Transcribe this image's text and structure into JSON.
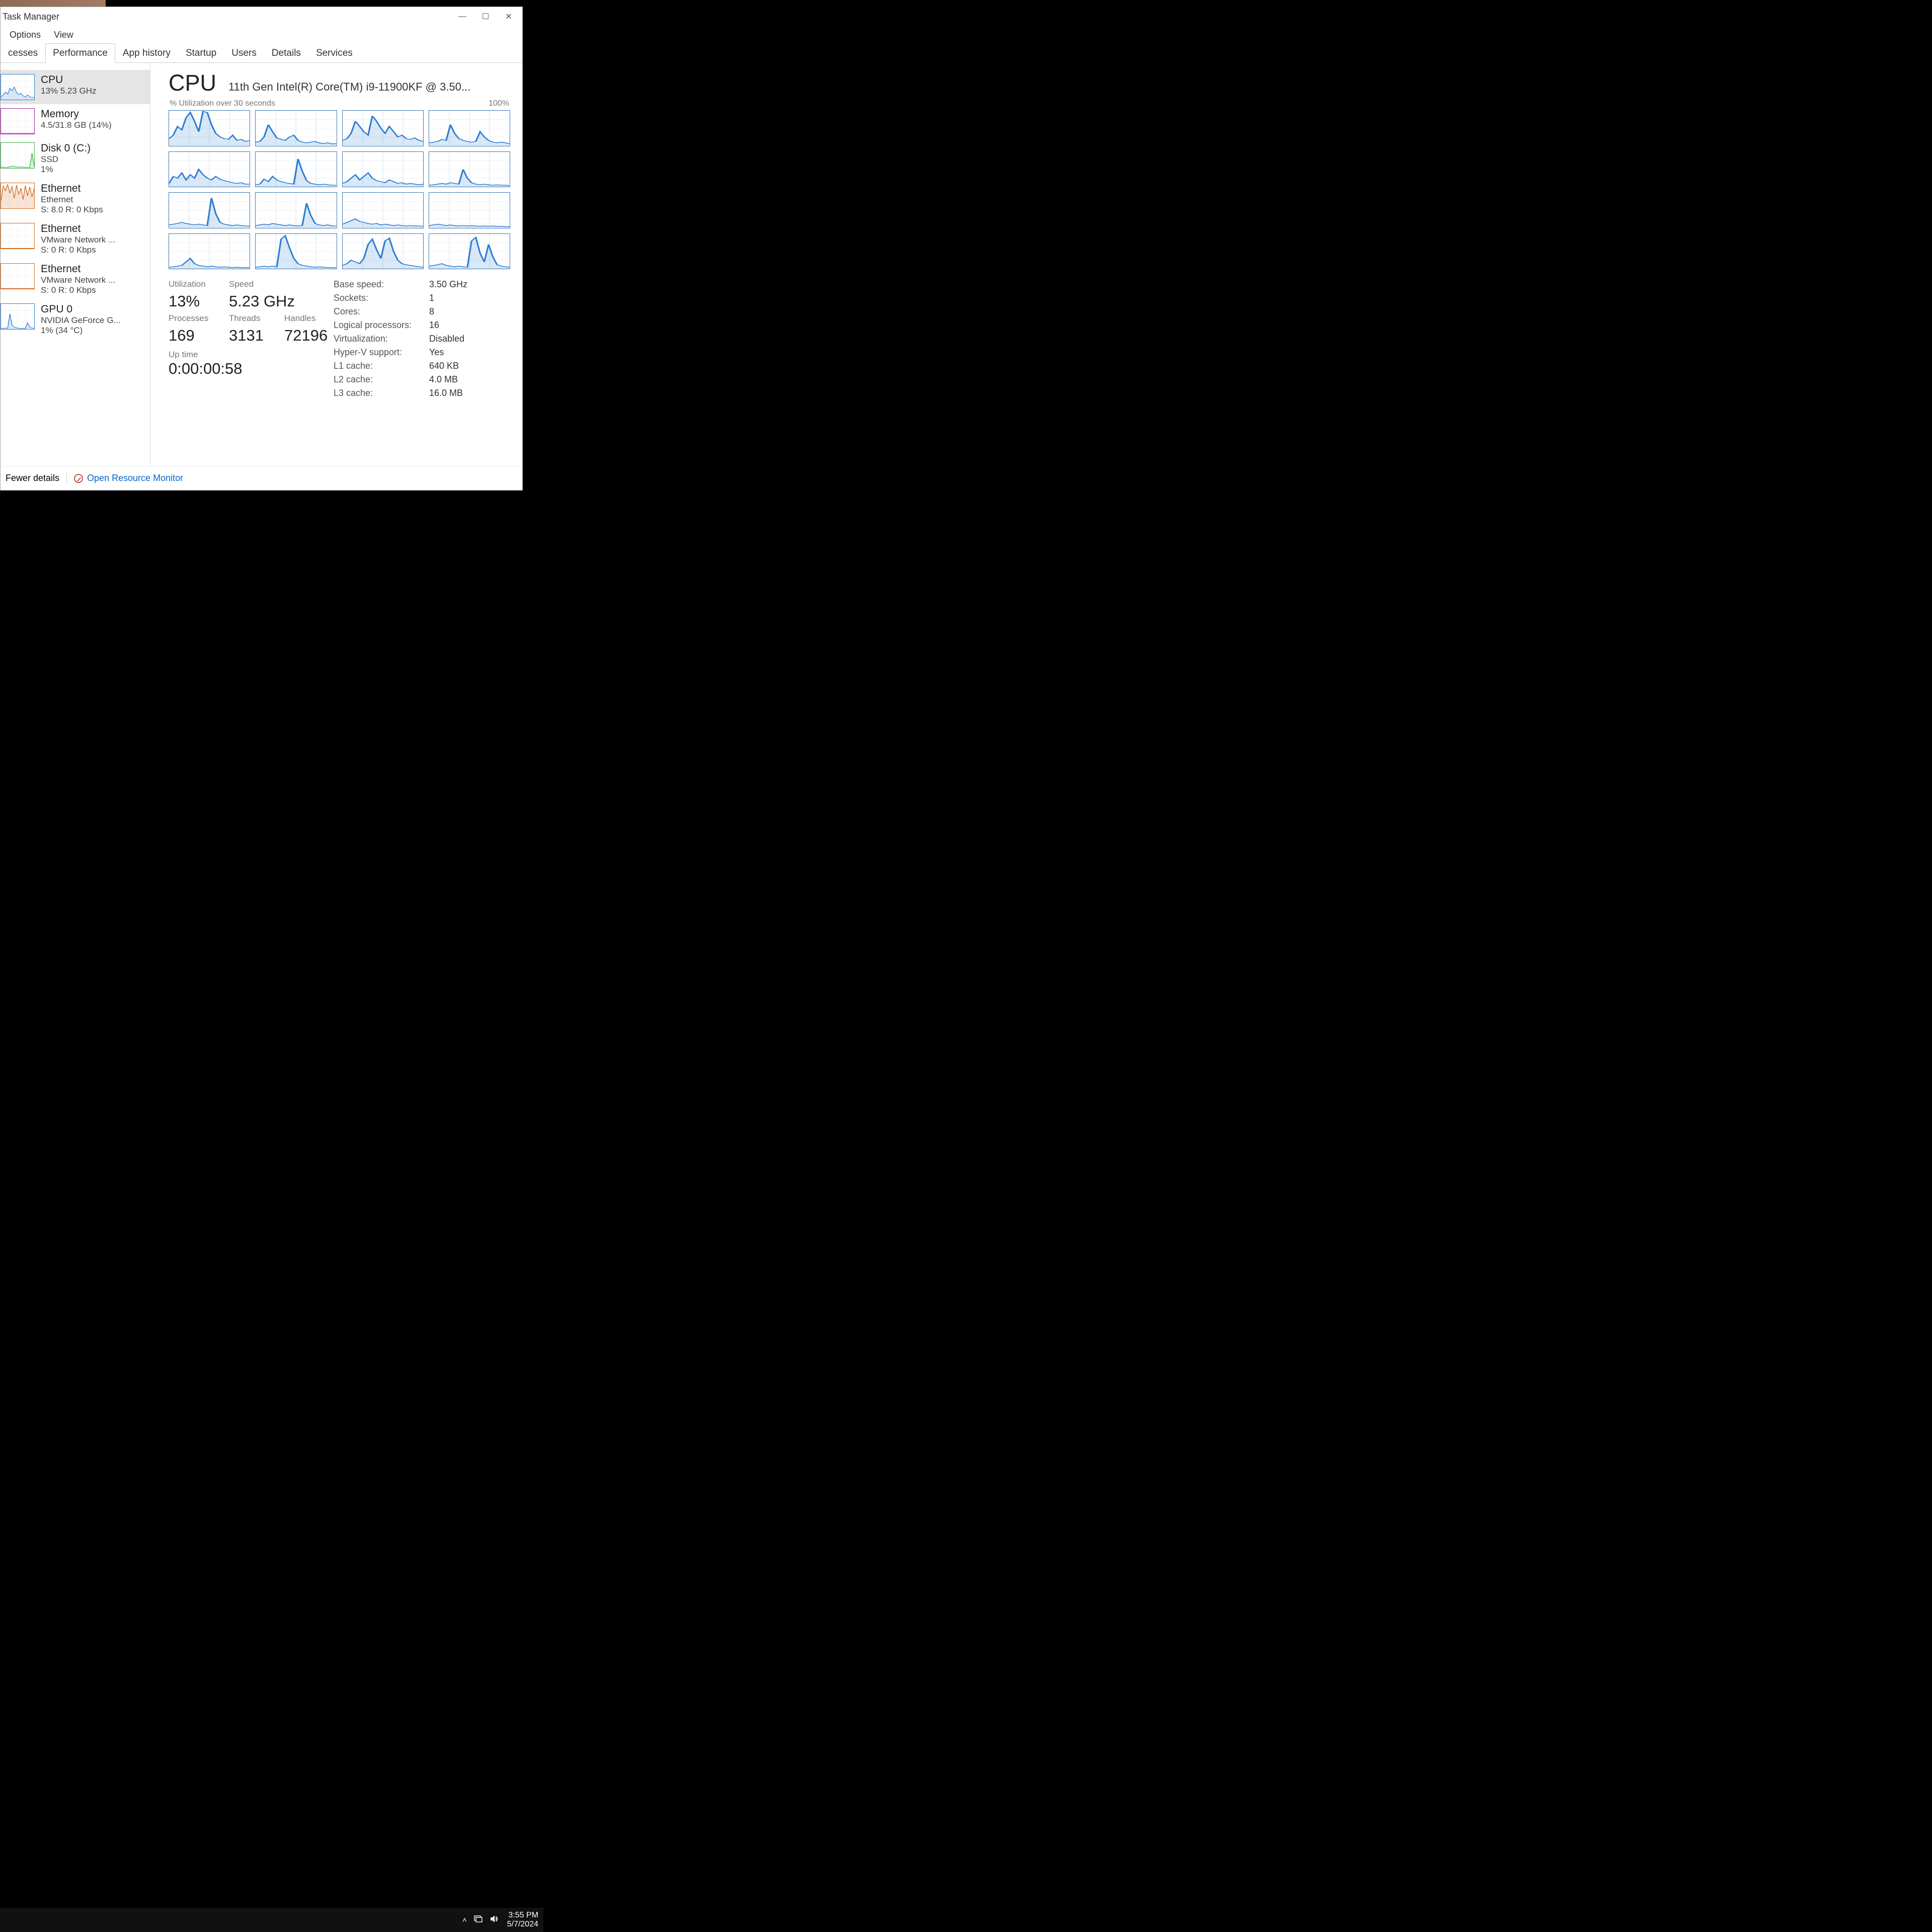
{
  "window": {
    "title": "Task Manager",
    "controls": {
      "min": "—",
      "max": "☐",
      "close": "✕"
    }
  },
  "menu": {
    "items": [
      "Options",
      "View"
    ]
  },
  "tabs": {
    "items": [
      "cesses",
      "Performance",
      "App history",
      "Startup",
      "Users",
      "Details",
      "Services"
    ],
    "active_index": 1
  },
  "sidebar": {
    "items": [
      {
        "id": "cpu",
        "title": "CPU",
        "line2": "13%  5.23 GHz",
        "color": "#2d7dd2"
      },
      {
        "id": "memory",
        "title": "Memory",
        "line2": "4.5/31.8 GB (14%)",
        "color": "#a020a0"
      },
      {
        "id": "disk0",
        "title": "Disk 0 (C:)",
        "line2": "SSD",
        "line3": "1%",
        "color": "#3cb043"
      },
      {
        "id": "eth0",
        "title": "Ethernet",
        "line2": "Ethernet",
        "line3": "S: 8.0 R: 0 Kbps",
        "color": "#d2691e"
      },
      {
        "id": "eth1",
        "title": "Ethernet",
        "line2": "VMware Network ...",
        "line3": "S: 0 R: 0 Kbps",
        "color": "#d2691e"
      },
      {
        "id": "eth2",
        "title": "Ethernet",
        "line2": "VMware Network ...",
        "line3": "S: 0 R: 0 Kbps",
        "color": "#d2691e"
      },
      {
        "id": "gpu0",
        "title": "GPU 0",
        "line2": "NVIDIA GeForce G...",
        "line3": "1%  (34 °C)",
        "color": "#2d7dd2"
      }
    ],
    "selected_index": 0
  },
  "main": {
    "heading": "CPU",
    "model": "11th Gen Intel(R) Core(TM) i9-11900KF @ 3.50...",
    "chart_left_label": "% Utilization over 30 seconds",
    "chart_right_label": "100%"
  },
  "stats_left": {
    "utilization_label": "Utilization",
    "utilization_value": "13%",
    "speed_label": "Speed",
    "speed_value": "5.23 GHz",
    "processes_label": "Processes",
    "processes_value": "169",
    "threads_label": "Threads",
    "threads_value": "3131",
    "handles_label": "Handles",
    "handles_value": "72196",
    "uptime_label": "Up time",
    "uptime_value": "0:00:00:58"
  },
  "stats_right": [
    {
      "label": "Base speed:",
      "value": "3.50 GHz"
    },
    {
      "label": "Sockets:",
      "value": "1"
    },
    {
      "label": "Cores:",
      "value": "8"
    },
    {
      "label": "Logical processors:",
      "value": "16"
    },
    {
      "label": "Virtualization:",
      "value": "Disabled"
    },
    {
      "label": "Hyper-V support:",
      "value": "Yes"
    },
    {
      "label": "L1 cache:",
      "value": "640 KB"
    },
    {
      "label": "L2 cache:",
      "value": "4.0 MB"
    },
    {
      "label": "L3 cache:",
      "value": "16.0 MB"
    }
  ],
  "footer": {
    "fewer_details": "Fewer details",
    "resource_monitor": "Open Resource Monitor"
  },
  "taskbar": {
    "time": "3:55 PM",
    "date": "5/7/2024"
  },
  "chart_data": {
    "type": "line",
    "title": "% Utilization over 30 seconds",
    "x_range_seconds": 30,
    "ylim": [
      0,
      100
    ],
    "series_count": 16,
    "note": "16 logical-processor sparklines; values approximated from pixels",
    "series": [
      {
        "name": "LP0",
        "values": [
          20,
          30,
          55,
          45,
          80,
          95,
          70,
          40,
          98,
          95,
          60,
          35,
          25,
          20,
          18,
          30,
          15,
          18,
          12,
          15
        ]
      },
      {
        "name": "LP1",
        "values": [
          10,
          12,
          25,
          60,
          40,
          22,
          18,
          15,
          25,
          30,
          15,
          10,
          8,
          10,
          12,
          8,
          6,
          8,
          5,
          6
        ]
      },
      {
        "name": "LP2",
        "values": [
          15,
          20,
          35,
          70,
          55,
          40,
          30,
          85,
          70,
          50,
          35,
          55,
          40,
          25,
          30,
          20,
          18,
          22,
          15,
          12
        ]
      },
      {
        "name": "LP3",
        "values": [
          8,
          10,
          12,
          18,
          15,
          60,
          35,
          20,
          15,
          12,
          10,
          12,
          40,
          25,
          15,
          10,
          8,
          10,
          8,
          6
        ]
      },
      {
        "name": "LP4",
        "values": [
          10,
          30,
          25,
          40,
          20,
          35,
          25,
          50,
          35,
          25,
          20,
          30,
          22,
          18,
          15,
          12,
          10,
          12,
          8,
          8
        ]
      },
      {
        "name": "LP5",
        "values": [
          6,
          8,
          22,
          15,
          30,
          20,
          15,
          12,
          10,
          8,
          80,
          45,
          18,
          10,
          8,
          6,
          8,
          6,
          5,
          5
        ]
      },
      {
        "name": "LP6",
        "values": [
          10,
          15,
          25,
          35,
          20,
          30,
          40,
          25,
          18,
          15,
          12,
          20,
          15,
          10,
          12,
          8,
          10,
          8,
          6,
          8
        ]
      },
      {
        "name": "LP7",
        "values": [
          5,
          6,
          8,
          10,
          8,
          12,
          10,
          8,
          50,
          25,
          12,
          8,
          6,
          8,
          6,
          5,
          6,
          5,
          5,
          4
        ]
      },
      {
        "name": "LP8",
        "values": [
          8,
          10,
          12,
          15,
          12,
          10,
          8,
          10,
          8,
          6,
          85,
          40,
          15,
          10,
          8,
          6,
          8,
          6,
          5,
          5
        ]
      },
      {
        "name": "LP9",
        "values": [
          6,
          8,
          10,
          8,
          12,
          10,
          8,
          6,
          8,
          6,
          5,
          6,
          70,
          35,
          12,
          8,
          6,
          8,
          5,
          5
        ]
      },
      {
        "name": "LP10",
        "values": [
          10,
          15,
          20,
          25,
          18,
          15,
          12,
          10,
          12,
          8,
          10,
          8,
          6,
          8,
          6,
          5,
          6,
          5,
          5,
          4
        ]
      },
      {
        "name": "LP11",
        "values": [
          6,
          8,
          10,
          8,
          6,
          8,
          6,
          5,
          6,
          5,
          6,
          5,
          4,
          5,
          4,
          5,
          4,
          4,
          3,
          3
        ]
      },
      {
        "name": "LP12",
        "values": [
          5,
          6,
          8,
          10,
          20,
          30,
          15,
          10,
          8,
          6,
          8,
          6,
          5,
          6,
          5,
          4,
          5,
          4,
          4,
          3
        ]
      },
      {
        "name": "LP13",
        "values": [
          5,
          6,
          8,
          6,
          8,
          6,
          85,
          95,
          60,
          30,
          15,
          10,
          8,
          6,
          5,
          6,
          5,
          4,
          4,
          3
        ]
      },
      {
        "name": "LP14",
        "values": [
          10,
          15,
          25,
          20,
          15,
          30,
          70,
          85,
          55,
          30,
          80,
          88,
          50,
          25,
          15,
          12,
          10,
          8,
          6,
          5
        ]
      },
      {
        "name": "LP15",
        "values": [
          8,
          10,
          12,
          15,
          10,
          8,
          6,
          8,
          6,
          5,
          80,
          90,
          45,
          20,
          70,
          35,
          12,
          8,
          6,
          5
        ]
      }
    ]
  }
}
